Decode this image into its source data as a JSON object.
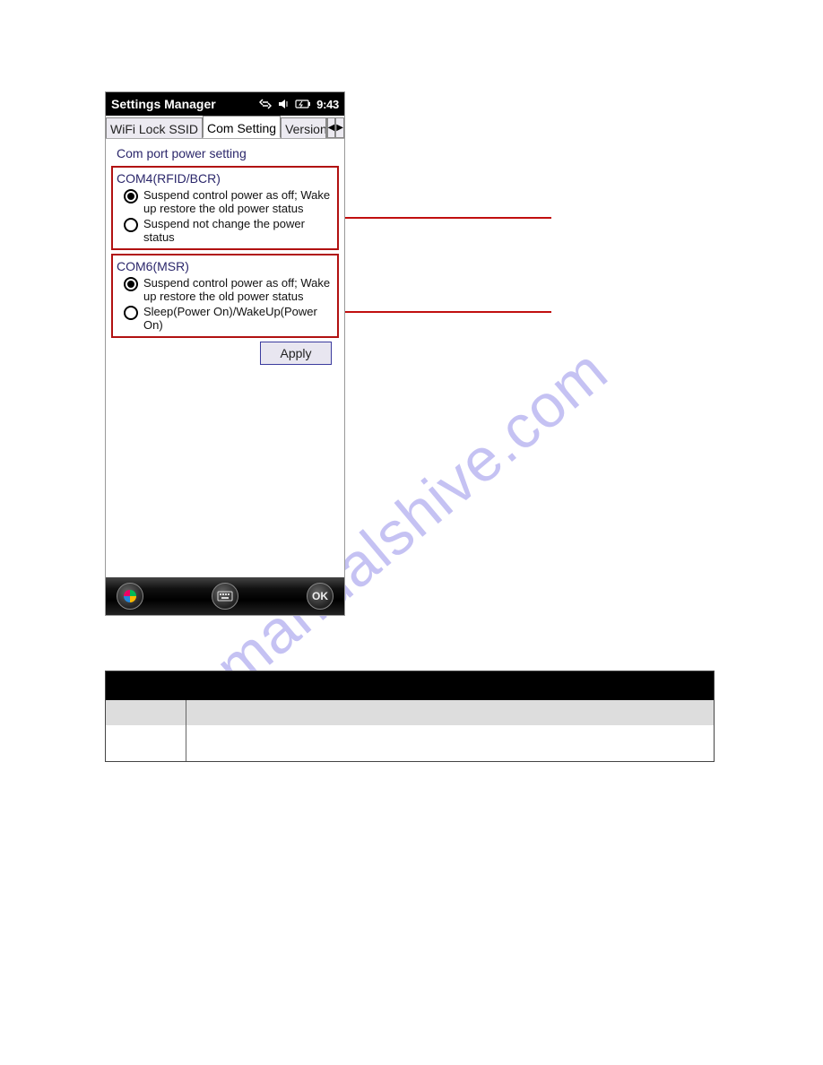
{
  "titlebar": {
    "title": "Settings Manager",
    "time": "9:43"
  },
  "tabs": {
    "items": [
      {
        "label": "WiFi Lock SSID"
      },
      {
        "label": "Com Setting"
      },
      {
        "label": "Version a"
      }
    ]
  },
  "content": {
    "title": "Com port power setting",
    "groups": [
      {
        "title": "COM4(RFID/BCR)",
        "options": [
          {
            "label": "Suspend control power as off; Wake up restore the old power status",
            "selected": true
          },
          {
            "label": "Suspend not change the power status",
            "selected": false
          }
        ]
      },
      {
        "title": "COM6(MSR)",
        "options": [
          {
            "label": "Suspend control power as off; Wake up restore the old power status",
            "selected": true
          },
          {
            "label": "Sleep(Power On)/WakeUp(Power On)",
            "selected": false
          }
        ]
      }
    ],
    "apply_label": "Apply"
  },
  "bottombar": {
    "ok_label": "OK"
  },
  "watermark": "manualshive.com"
}
